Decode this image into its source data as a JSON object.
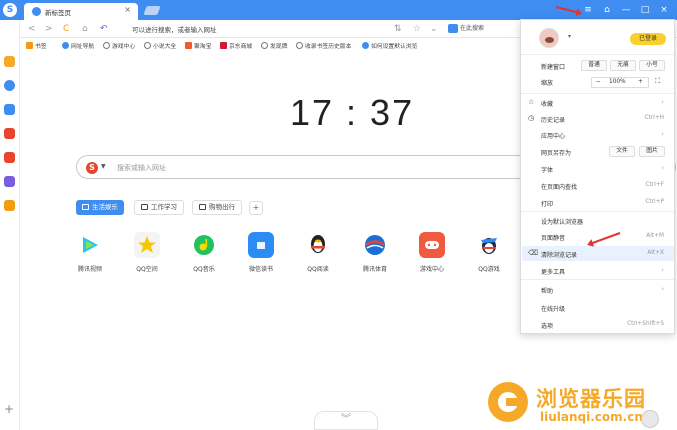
{
  "titlebar": {
    "app_logo": "S",
    "tab_title": "新标签页",
    "tab_close": "×",
    "window_controls": [
      "≡",
      "⌂",
      "—",
      "□",
      "×"
    ]
  },
  "addressbar": {
    "nav": [
      "<",
      ">",
      "C",
      "⌂",
      "↶"
    ],
    "url_placeholder": "可以进行搜索，或者输入网址",
    "search_engine_label": "在此搜索"
  },
  "bookmarks": [
    {
      "label": "书签",
      "icon": "star",
      "color": "#f39c12"
    },
    {
      "label": "网址导航",
      "icon": "compass",
      "color": "#3f8df0"
    },
    {
      "label": "游戏中心",
      "icon": "globe",
      "color": "#777777"
    },
    {
      "label": "小说大全",
      "icon": "globe",
      "color": "#777777"
    },
    {
      "label": "聚淘宝",
      "icon": "taobao",
      "color": "#f25b28"
    },
    {
      "label": "京东商城",
      "icon": "jd",
      "color": "#d11a2d"
    },
    {
      "label": "发现牌",
      "icon": "globe",
      "color": "#777777"
    },
    {
      "label": "收录书签历史版本",
      "icon": "globe",
      "color": "#777777"
    },
    {
      "label": "如何设置默认浏览",
      "icon": "help",
      "color": "#3f8df0"
    }
  ],
  "sidebar": {
    "icons": [
      {
        "name": "favorites-sidebar-icon",
        "color": "#f6a928"
      },
      {
        "name": "history-sidebar-icon",
        "color": "#3f8df0"
      },
      {
        "name": "cloud-sidebar-icon",
        "color": "#3f8df0"
      },
      {
        "name": "weibo-sidebar-icon",
        "color": "#e8452e"
      },
      {
        "name": "pdf-sidebar-icon",
        "color": "#e8452e"
      },
      {
        "name": "notes-sidebar-icon",
        "color": "#7b5de0"
      },
      {
        "name": "translate-sidebar-icon",
        "color": "#f39c12"
      }
    ],
    "add": "+"
  },
  "main": {
    "clock": "17 : 37",
    "search_placeholder": "搜索或输入网址",
    "search_engine_glyph": "S",
    "categories": [
      {
        "label": "生活娱乐",
        "active": true
      },
      {
        "label": "工作学习",
        "active": false
      },
      {
        "label": "购物出行",
        "active": false
      }
    ],
    "category_add": "+",
    "shortcuts": [
      {
        "label": "腾讯视频",
        "color": "#1ec9f4"
      },
      {
        "label": "QQ空间",
        "color": "#f7c800"
      },
      {
        "label": "QQ音乐",
        "color": "#21c15e"
      },
      {
        "label": "微信读书",
        "color": "#2c8cf4"
      },
      {
        "label": "QQ阅读",
        "color": "#222222"
      },
      {
        "label": "腾讯体育",
        "color": "#1a6fd6"
      },
      {
        "label": "游戏中心",
        "color": "#f05a3e"
      },
      {
        "label": "QQ游戏",
        "color": "#1f2a44"
      }
    ],
    "scroll_down": "︾"
  },
  "watermark": {
    "title": "浏览器乐园",
    "url": "liulanqi.com.cn"
  },
  "menu": {
    "login_label": "已登录",
    "row1": {
      "new_window": "新建窗口",
      "normal": "普通",
      "traceless": "无痕",
      "small": "小号"
    },
    "zoom": {
      "label": "缩放",
      "minus": "−",
      "value": "100%",
      "plus": "+",
      "fullscreen": "⛶"
    },
    "items": [
      {
        "label": "收藏",
        "shortcut": "",
        "arrow": true,
        "icon": "☆"
      },
      {
        "label": "历史记录",
        "shortcut": "Ctrl+H",
        "arrow": false,
        "icon": "◷"
      },
      {
        "label": "应用中心",
        "shortcut": "",
        "arrow": true,
        "icon": ""
      },
      {
        "label": "网页另存为",
        "shortcut": "",
        "arrow": false,
        "icon": ""
      },
      {
        "label": "字体",
        "shortcut": "",
        "arrow": true,
        "icon": ""
      },
      {
        "label": "在页面内查找",
        "shortcut": "Ctrl+F",
        "arrow": false,
        "icon": ""
      },
      {
        "label": "打印",
        "shortcut": "Ctrl+P",
        "arrow": false,
        "icon": ""
      },
      {
        "label": "设为默认浏览器",
        "shortcut": "",
        "arrow": false,
        "icon": ""
      },
      {
        "label": "页面静音",
        "shortcut": "Alt+M",
        "arrow": false,
        "icon": ""
      },
      {
        "label": "清除浏览记录",
        "shortcut": "Alt+X",
        "arrow": false,
        "icon": "⌫"
      },
      {
        "label": "更多工具",
        "shortcut": "",
        "arrow": true,
        "icon": ""
      },
      {
        "label": "帮助",
        "shortcut": "",
        "arrow": true,
        "icon": ""
      },
      {
        "label": "在线升级",
        "shortcut": "",
        "arrow": false,
        "icon": ""
      },
      {
        "label": "选项",
        "shortcut": "Ctrl+Shift+S",
        "arrow": false,
        "icon": ""
      }
    ],
    "save_as_buttons": [
      "文件",
      "图片"
    ]
  }
}
